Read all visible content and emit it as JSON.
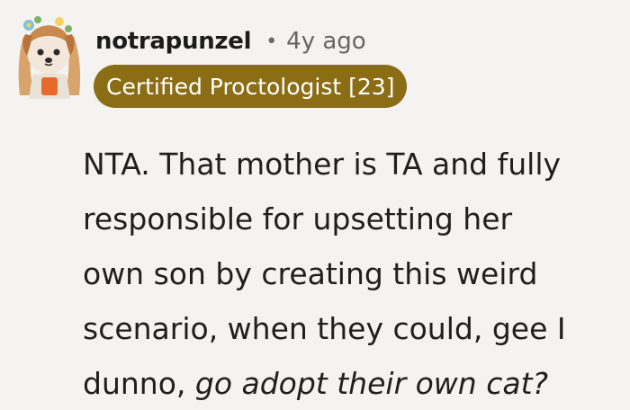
{
  "comment": {
    "author": "notrapunzel",
    "separator": "•",
    "age": "4y ago",
    "flair": "Certified Proctologist [23]",
    "body_lines": [
      "NTA. That mother is TA and fully",
      "responsible for upsetting her",
      "own son by creating this weird",
      "scenario, when they could, gee I"
    ],
    "body_last_plain": "dunno, ",
    "body_last_italic": "go adopt their own cat?"
  },
  "colors": {
    "background": "#f4f3f2",
    "flair_background": "#8a6d14",
    "flair_text": "#ffffff",
    "username": "#1c1c1c",
    "meta": "#666666",
    "body": "#1f1f1f"
  },
  "icons": {
    "avatar": "user-avatar-image"
  }
}
